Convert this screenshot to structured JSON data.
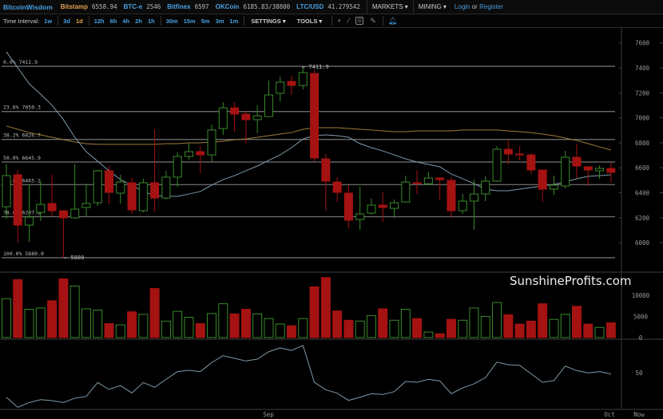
{
  "topbar": {
    "brand": "BitcoinWisdom",
    "exchanges": [
      {
        "name": "Bitstamp",
        "value": "6558.94",
        "color": "#e0a050"
      },
      {
        "name": "BTC-e",
        "value": "2546",
        "color": "#4a9fe0"
      },
      {
        "name": "Bitfinex",
        "value": "6597",
        "color": "#4a9fe0"
      },
      {
        "name": "OKCoin",
        "value": "6185.83/38800",
        "color": "#4a9fe0"
      },
      {
        "name": "LTC/USD",
        "value": "41.279542",
        "color": "#4a9fe0"
      }
    ],
    "markets": "MARKETS ▾",
    "mining": "MINING ▾",
    "login": "Login",
    "or": "or",
    "register": "Register"
  },
  "toolbar": {
    "time_interval_label": "Time Interval:",
    "intervals": [
      "1w",
      "3d",
      "1d",
      "12h",
      "6h",
      "4h",
      "2h",
      "1h",
      "30m",
      "15m",
      "5m",
      "3m",
      "1m"
    ],
    "selected_interval": "1d",
    "settings": "SETTINGS ▾",
    "tools": "TOOLS ▾",
    "icons": [
      "crosshair-icon",
      "line-icon",
      "fib-icon",
      "pen-icon",
      "bell-icon"
    ]
  },
  "watermark": "SunshineProfits.com",
  "colors": {
    "up": "#3a8a2a",
    "down": "#a51212",
    "ma_fast": "#7f99aa",
    "ma_slow": "#a07a3a",
    "fib": "#777777"
  },
  "chart_data": {
    "type": "candlestick",
    "price_axis": {
      "ticks": [
        7600,
        7400,
        7200,
        7000,
        6800,
        6600,
        6400,
        6200,
        6000
      ]
    },
    "volume_axis": {
      "ticks": [
        10000,
        5000,
        0
      ]
    },
    "rsi_axis": {
      "ticks": [
        50
      ]
    },
    "time_labels": [
      "Sep",
      "Oct",
      "Now"
    ],
    "high_marker": "← 7411.9",
    "low_marker": "← 5880",
    "fib_levels": [
      {
        "label": "0.0% 7411.9",
        "price": 7411.9
      },
      {
        "label": "23.6% 7050.3",
        "price": 7050.3
      },
      {
        "label": "38.2% 6826.7",
        "price": 6826.7
      },
      {
        "label": "50.0% 6645.9",
        "price": 6645.9
      },
      {
        "label": "61.8% 6465.2",
        "price": 6465.2
      },
      {
        "label": "78.6% 6207.8",
        "price": 6207.8
      },
      {
        "label": "100.0% 5880.0",
        "price": 5880.0
      }
    ],
    "ohlc": [
      [
        6288,
        6627,
        6192,
        6537
      ],
      [
        6544,
        6582,
        6000,
        6141
      ],
      [
        6141,
        6467,
        6007,
        6205
      ],
      [
        6243,
        6493,
        6173,
        6307
      ],
      [
        6314,
        6544,
        6211,
        6256
      ],
      [
        6256,
        6260,
        5880,
        6199
      ],
      [
        6199,
        6627,
        6192,
        6269
      ],
      [
        6282,
        6473,
        6205,
        6314
      ],
      [
        6320,
        6582,
        6294,
        6576
      ],
      [
        6576,
        6614,
        6307,
        6403
      ],
      [
        6397,
        6544,
        6314,
        6486
      ],
      [
        6480,
        6518,
        6231,
        6263
      ],
      [
        6256,
        6512,
        6243,
        6480
      ],
      [
        6480,
        6908,
        6250,
        6358
      ],
      [
        6358,
        6576,
        6346,
        6525
      ],
      [
        6525,
        6723,
        6448,
        6691
      ],
      [
        6691,
        6799,
        6665,
        6729
      ],
      [
        6729,
        6774,
        6557,
        6703
      ],
      [
        6703,
        6946,
        6646,
        6902
      ],
      [
        6914,
        7125,
        6863,
        7080
      ],
      [
        7080,
        7125,
        6889,
        7029
      ],
      [
        7029,
        7055,
        6793,
        6985
      ],
      [
        6985,
        7100,
        6876,
        7016
      ],
      [
        7010,
        7298,
        7010,
        7183
      ],
      [
        7196,
        7330,
        7132,
        7285
      ],
      [
        7291,
        7336,
        7183,
        7259
      ],
      [
        7259,
        7412,
        7228,
        7362
      ],
      [
        7355,
        7387,
        6652,
        6678
      ],
      [
        6671,
        6710,
        6256,
        6493
      ],
      [
        6486,
        6525,
        6326,
        6403
      ],
      [
        6397,
        6461,
        6116,
        6180
      ],
      [
        6186,
        6448,
        6103,
        6231
      ],
      [
        6237,
        6352,
        6224,
        6301
      ],
      [
        6301,
        6403,
        6167,
        6282
      ],
      [
        6275,
        6346,
        6199,
        6320
      ],
      [
        6326,
        6537,
        6326,
        6486
      ],
      [
        6480,
        6582,
        6390,
        6473
      ],
      [
        6473,
        6569,
        6461,
        6518
      ],
      [
        6518,
        6525,
        6346,
        6505
      ],
      [
        6499,
        6525,
        6205,
        6256
      ],
      [
        6256,
        6390,
        6231,
        6333
      ],
      [
        6333,
        6505,
        6103,
        6390
      ],
      [
        6390,
        6531,
        6333,
        6493
      ],
      [
        6493,
        6774,
        6486,
        6748
      ],
      [
        6748,
        6825,
        6627,
        6710
      ],
      [
        6710,
        6774,
        6659,
        6703
      ],
      [
        6703,
        6716,
        6550,
        6582
      ],
      [
        6582,
        6582,
        6326,
        6429
      ],
      [
        6429,
        6537,
        6384,
        6461
      ],
      [
        6454,
        6735,
        6435,
        6684
      ],
      [
        6684,
        6793,
        6518,
        6614
      ],
      [
        6608,
        6608,
        6454,
        6582
      ],
      [
        6576,
        6620,
        6512,
        6595
      ],
      [
        6595,
        6640,
        6480,
        6563
      ]
    ],
    "volume": [
      9200,
      13700,
      6700,
      7000,
      8700,
      13900,
      12200,
      6800,
      6500,
      3300,
      3000,
      6100,
      5500,
      11600,
      3900,
      6200,
      4800,
      3300,
      5700,
      8000,
      5600,
      6700,
      5600,
      4500,
      3200,
      2800,
      4500,
      12000,
      14200,
      6300,
      4100,
      3900,
      5200,
      6800,
      4100,
      6700,
      4500,
      1300,
      900,
      4300,
      4100,
      7000,
      5000,
      8300,
      5400,
      3200,
      3900,
      8000,
      4300,
      5500,
      7400,
      3200,
      2400,
      3500
    ],
    "ma_fast": [
      7528,
      7400,
      7272,
      7189,
      7100,
      6985,
      6844,
      6729,
      6652,
      6576,
      6505,
      6461,
      6410,
      6378,
      6371,
      6371,
      6390,
      6410,
      6461,
      6505,
      6537,
      6576,
      6614,
      6659,
      6703,
      6761,
      6831,
      6857,
      6863,
      6857,
      6844,
      6793,
      6761,
      6735,
      6703,
      6671,
      6646,
      6627,
      6608,
      6550,
      6512,
      6473,
      6429,
      6416,
      6416,
      6429,
      6442,
      6454,
      6467,
      6486,
      6512,
      6531,
      6537,
      6544
    ],
    "ma_slow": [
      6934,
      6908,
      6882,
      6863,
      6844,
      6825,
      6806,
      6793,
      6787,
      6787,
      6787,
      6787,
      6787,
      6787,
      6793,
      6793,
      6799,
      6799,
      6806,
      6812,
      6825,
      6831,
      6844,
      6857,
      6870,
      6882,
      6908,
      6921,
      6921,
      6921,
      6914,
      6908,
      6902,
      6895,
      6889,
      6889,
      6895,
      6895,
      6895,
      6895,
      6902,
      6902,
      6902,
      6902,
      6895,
      6889,
      6882,
      6870,
      6857,
      6838,
      6819,
      6793,
      6767,
      6742
    ],
    "rsi": [
      29.5,
      21.1,
      25.1,
      27.5,
      26.7,
      25.1,
      28.7,
      30.2,
      41.8,
      36,
      39.3,
      33.1,
      41.8,
      37.8,
      44.5,
      50.9,
      52,
      50.9,
      58.5,
      64.2,
      62,
      59.8,
      61.3,
      67.5,
      70.7,
      68.7,
      72.7,
      42,
      35.8,
      32.9,
      26.9,
      29.5,
      32.5,
      31.8,
      34.2,
      42.7,
      42,
      44.5,
      43.1,
      32.5,
      37.3,
      40.7,
      46,
      58.9,
      56.7,
      56.2,
      49.1,
      42,
      43.5,
      55.5,
      51.8,
      49.8,
      50.9,
      48.9
    ]
  }
}
